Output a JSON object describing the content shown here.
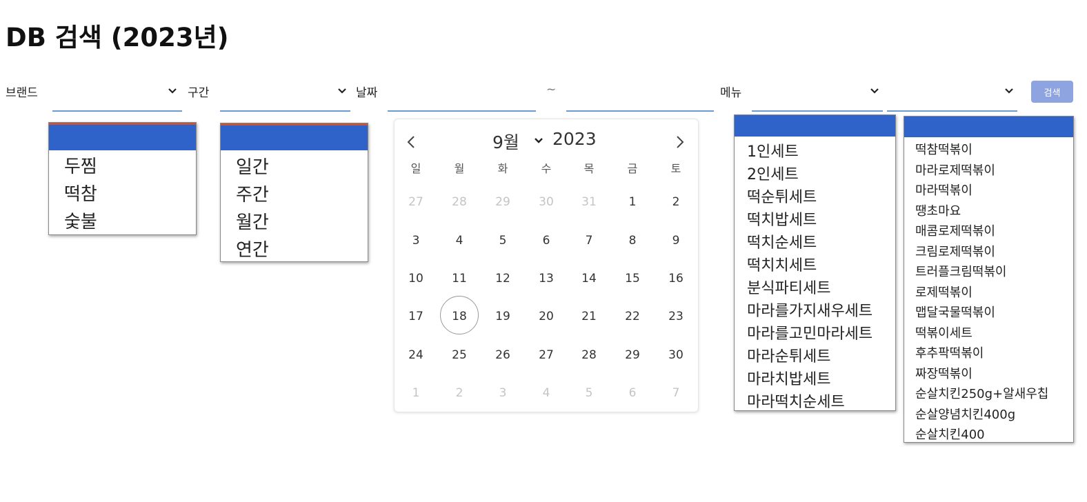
{
  "page": {
    "title": "DB 검색 (2023년)"
  },
  "filters": {
    "brand_label": "브랜드",
    "period_label": "구간",
    "date_label": "날짜",
    "date_separator": "~",
    "menu_label": "메뉴",
    "search_button": "검색"
  },
  "brand_dropdown": {
    "options": [
      "두찜",
      "떡참",
      "숯불"
    ]
  },
  "period_dropdown": {
    "options": [
      "일간",
      "주간",
      "월간",
      "연간"
    ]
  },
  "calendar": {
    "month_label": "9월",
    "year_label": "2023",
    "weekdays": [
      "일",
      "월",
      "화",
      "수",
      "목",
      "금",
      "토"
    ],
    "weeks": [
      [
        "27",
        "28",
        "29",
        "30",
        "31",
        "1",
        "2"
      ],
      [
        "3",
        "4",
        "5",
        "6",
        "7",
        "8",
        "9"
      ],
      [
        "10",
        "11",
        "12",
        "13",
        "14",
        "15",
        "16"
      ],
      [
        "17",
        "18",
        "19",
        "20",
        "21",
        "22",
        "23"
      ],
      [
        "24",
        "25",
        "26",
        "27",
        "28",
        "29",
        "30"
      ],
      [
        "1",
        "2",
        "3",
        "4",
        "5",
        "6",
        "7"
      ]
    ],
    "today": "18"
  },
  "menu_set_dropdown": {
    "options": [
      "1인세트",
      "2인세트",
      "떡순튀세트",
      "떡치밥세트",
      "떡치순세트",
      "떡치치세트",
      "분식파티세트",
      "마라를가지새우세트",
      "마라를고민마라세트",
      "마라순튀세트",
      "마라치밥세트",
      "마라떡치순세트"
    ]
  },
  "menu_item_dropdown": {
    "options": [
      "떡참떡볶이",
      "마라로제떡볶이",
      "마라떡볶이",
      "땡초마요",
      "매콤로제떡볶이",
      "크림로제떡볶이",
      "트러플크림떡볶이",
      "로제떡볶이",
      "맵달국물떡볶이",
      "떡볶이세트",
      "후추팍떡볶이",
      "짜장떡볶이",
      "순살치킨250g+알새우칩",
      "순살양념치킨400g",
      "순살치킨400"
    ]
  },
  "colors": {
    "accent": "#3063c9",
    "field_underline": "#6b9bd0",
    "button_bg": "#8ea4e0",
    "dropdown_top_line": "#c0573a"
  },
  "icons": {
    "select_chevron": "chevron-down-icon",
    "prev": "chevron-left-icon",
    "next": "chevron-right-icon"
  }
}
